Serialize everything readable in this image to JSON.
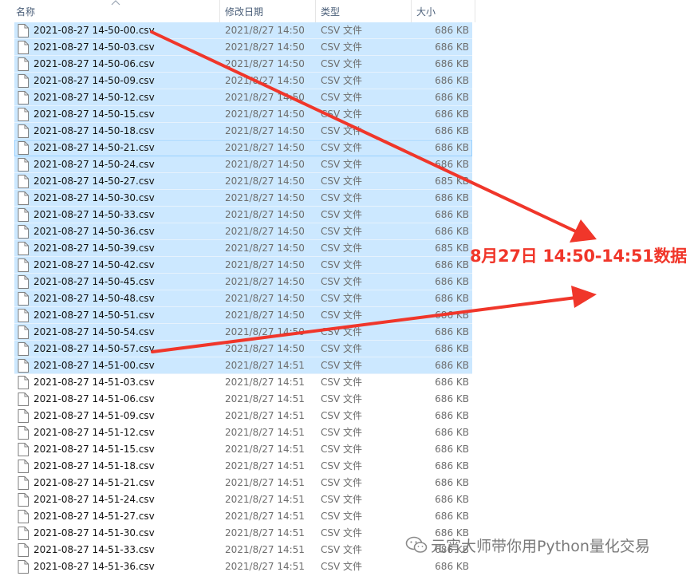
{
  "columns": {
    "name": "名称",
    "modified": "修改日期",
    "type": "类型",
    "size": "大小"
  },
  "files": [
    {
      "name": "2021-08-27 14-50-00.csv",
      "modified": "2021/8/27 14:50",
      "type": "CSV 文件",
      "size": "686 KB",
      "selected": true
    },
    {
      "name": "2021-08-27 14-50-03.csv",
      "modified": "2021/8/27 14:50",
      "type": "CSV 文件",
      "size": "686 KB",
      "selected": true
    },
    {
      "name": "2021-08-27 14-50-06.csv",
      "modified": "2021/8/27 14:50",
      "type": "CSV 文件",
      "size": "686 KB",
      "selected": true
    },
    {
      "name": "2021-08-27 14-50-09.csv",
      "modified": "2021/8/27 14:50",
      "type": "CSV 文件",
      "size": "686 KB",
      "selected": true
    },
    {
      "name": "2021-08-27 14-50-12.csv",
      "modified": "2021/8/27 14:50",
      "type": "CSV 文件",
      "size": "686 KB",
      "selected": true
    },
    {
      "name": "2021-08-27 14-50-15.csv",
      "modified": "2021/8/27 14:50",
      "type": "CSV 文件",
      "size": "686 KB",
      "selected": true
    },
    {
      "name": "2021-08-27 14-50-18.csv",
      "modified": "2021/8/27 14:50",
      "type": "CSV 文件",
      "size": "686 KB",
      "selected": true
    },
    {
      "name": "2021-08-27 14-50-21.csv",
      "modified": "2021/8/27 14:50",
      "type": "CSV 文件",
      "size": "686 KB",
      "selected": true,
      "focused": true
    },
    {
      "name": "2021-08-27 14-50-24.csv",
      "modified": "2021/8/27 14:50",
      "type": "CSV 文件",
      "size": "686 KB",
      "selected": true
    },
    {
      "name": "2021-08-27 14-50-27.csv",
      "modified": "2021/8/27 14:50",
      "type": "CSV 文件",
      "size": "685 KB",
      "selected": true
    },
    {
      "name": "2021-08-27 14-50-30.csv",
      "modified": "2021/8/27 14:50",
      "type": "CSV 文件",
      "size": "686 KB",
      "selected": true
    },
    {
      "name": "2021-08-27 14-50-33.csv",
      "modified": "2021/8/27 14:50",
      "type": "CSV 文件",
      "size": "686 KB",
      "selected": true
    },
    {
      "name": "2021-08-27 14-50-36.csv",
      "modified": "2021/8/27 14:50",
      "type": "CSV 文件",
      "size": "686 KB",
      "selected": true
    },
    {
      "name": "2021-08-27 14-50-39.csv",
      "modified": "2021/8/27 14:50",
      "type": "CSV 文件",
      "size": "685 KB",
      "selected": true
    },
    {
      "name": "2021-08-27 14-50-42.csv",
      "modified": "2021/8/27 14:50",
      "type": "CSV 文件",
      "size": "686 KB",
      "selected": true
    },
    {
      "name": "2021-08-27 14-50-45.csv",
      "modified": "2021/8/27 14:50",
      "type": "CSV 文件",
      "size": "686 KB",
      "selected": true
    },
    {
      "name": "2021-08-27 14-50-48.csv",
      "modified": "2021/8/27 14:50",
      "type": "CSV 文件",
      "size": "686 KB",
      "selected": true
    },
    {
      "name": "2021-08-27 14-50-51.csv",
      "modified": "2021/8/27 14:50",
      "type": "CSV 文件",
      "size": "686 KB",
      "selected": true
    },
    {
      "name": "2021-08-27 14-50-54.csv",
      "modified": "2021/8/27 14:50",
      "type": "CSV 文件",
      "size": "686 KB",
      "selected": true
    },
    {
      "name": "2021-08-27 14-50-57.csv",
      "modified": "2021/8/27 14:50",
      "type": "CSV 文件",
      "size": "686 KB",
      "selected": true
    },
    {
      "name": "2021-08-27 14-51-00.csv",
      "modified": "2021/8/27 14:51",
      "type": "CSV 文件",
      "size": "686 KB",
      "selected": true
    },
    {
      "name": "2021-08-27 14-51-03.csv",
      "modified": "2021/8/27 14:51",
      "type": "CSV 文件",
      "size": "686 KB",
      "selected": false
    },
    {
      "name": "2021-08-27 14-51-06.csv",
      "modified": "2021/8/27 14:51",
      "type": "CSV 文件",
      "size": "686 KB",
      "selected": false
    },
    {
      "name": "2021-08-27 14-51-09.csv",
      "modified": "2021/8/27 14:51",
      "type": "CSV 文件",
      "size": "686 KB",
      "selected": false
    },
    {
      "name": "2021-08-27 14-51-12.csv",
      "modified": "2021/8/27 14:51",
      "type": "CSV 文件",
      "size": "686 KB",
      "selected": false
    },
    {
      "name": "2021-08-27 14-51-15.csv",
      "modified": "2021/8/27 14:51",
      "type": "CSV 文件",
      "size": "686 KB",
      "selected": false
    },
    {
      "name": "2021-08-27 14-51-18.csv",
      "modified": "2021/8/27 14:51",
      "type": "CSV 文件",
      "size": "686 KB",
      "selected": false
    },
    {
      "name": "2021-08-27 14-51-21.csv",
      "modified": "2021/8/27 14:51",
      "type": "CSV 文件",
      "size": "686 KB",
      "selected": false
    },
    {
      "name": "2021-08-27 14-51-24.csv",
      "modified": "2021/8/27 14:51",
      "type": "CSV 文件",
      "size": "686 KB",
      "selected": false
    },
    {
      "name": "2021-08-27 14-51-27.csv",
      "modified": "2021/8/27 14:51",
      "type": "CSV 文件",
      "size": "686 KB",
      "selected": false
    },
    {
      "name": "2021-08-27 14-51-30.csv",
      "modified": "2021/8/27 14:51",
      "type": "CSV 文件",
      "size": "686 KB",
      "selected": false
    },
    {
      "name": "2021-08-27 14-51-33.csv",
      "modified": "2021/8/27 14:51",
      "type": "CSV 文件",
      "size": "686 KB",
      "selected": false
    },
    {
      "name": "2021-08-27 14-51-36.csv",
      "modified": "2021/8/27 14:51",
      "type": "CSV 文件",
      "size": "686 KB",
      "selected": false
    }
  ],
  "annotation": {
    "label": "8月27日 14:50-14:51数据",
    "color": "#f0362a"
  },
  "watermark": {
    "text": "元宵大师带你用Python量化交易",
    "icon": "wechat-icon"
  },
  "colors": {
    "selection": "#cce8ff",
    "header_text": "#4c607a"
  }
}
